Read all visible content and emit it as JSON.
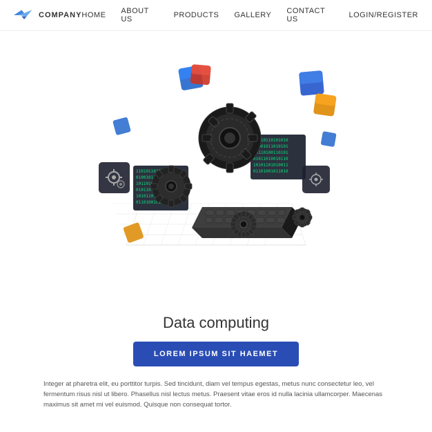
{
  "header": {
    "logo_text": "COMPANY",
    "nav": [
      {
        "label": "HOME",
        "id": "home"
      },
      {
        "label": "ABOUT US",
        "id": "about"
      },
      {
        "label": "PRODUCTS",
        "id": "products"
      },
      {
        "label": "GALLERY",
        "id": "gallery"
      },
      {
        "label": "CONTACT US",
        "id": "contact"
      },
      {
        "label": "LOGIN/REGISTER",
        "id": "login"
      }
    ]
  },
  "main": {
    "title": "Data computing",
    "cta_label": "LOREM IPSUM SIT HAEMET",
    "body_text": "Integer at pharetra elit, eu porttitor turpis. Sed tincidunt, diam vel tempus egestas, metus nunc consectetur leo, vel fermentum risus nisl ut libero. Phasellus nisl lectus metus. Praesent vitae eros id nulla lacinia ullamcorper. Maecenas maximus sit amet mi vel euismod. Quisque non consequat tortor."
  },
  "colors": {
    "blue_dark": "#2a4db5",
    "blue_bright": "#3399ff",
    "red": "#e63333",
    "orange": "#ff9900",
    "gear_dark": "#222222",
    "gear_mid": "#555555"
  }
}
